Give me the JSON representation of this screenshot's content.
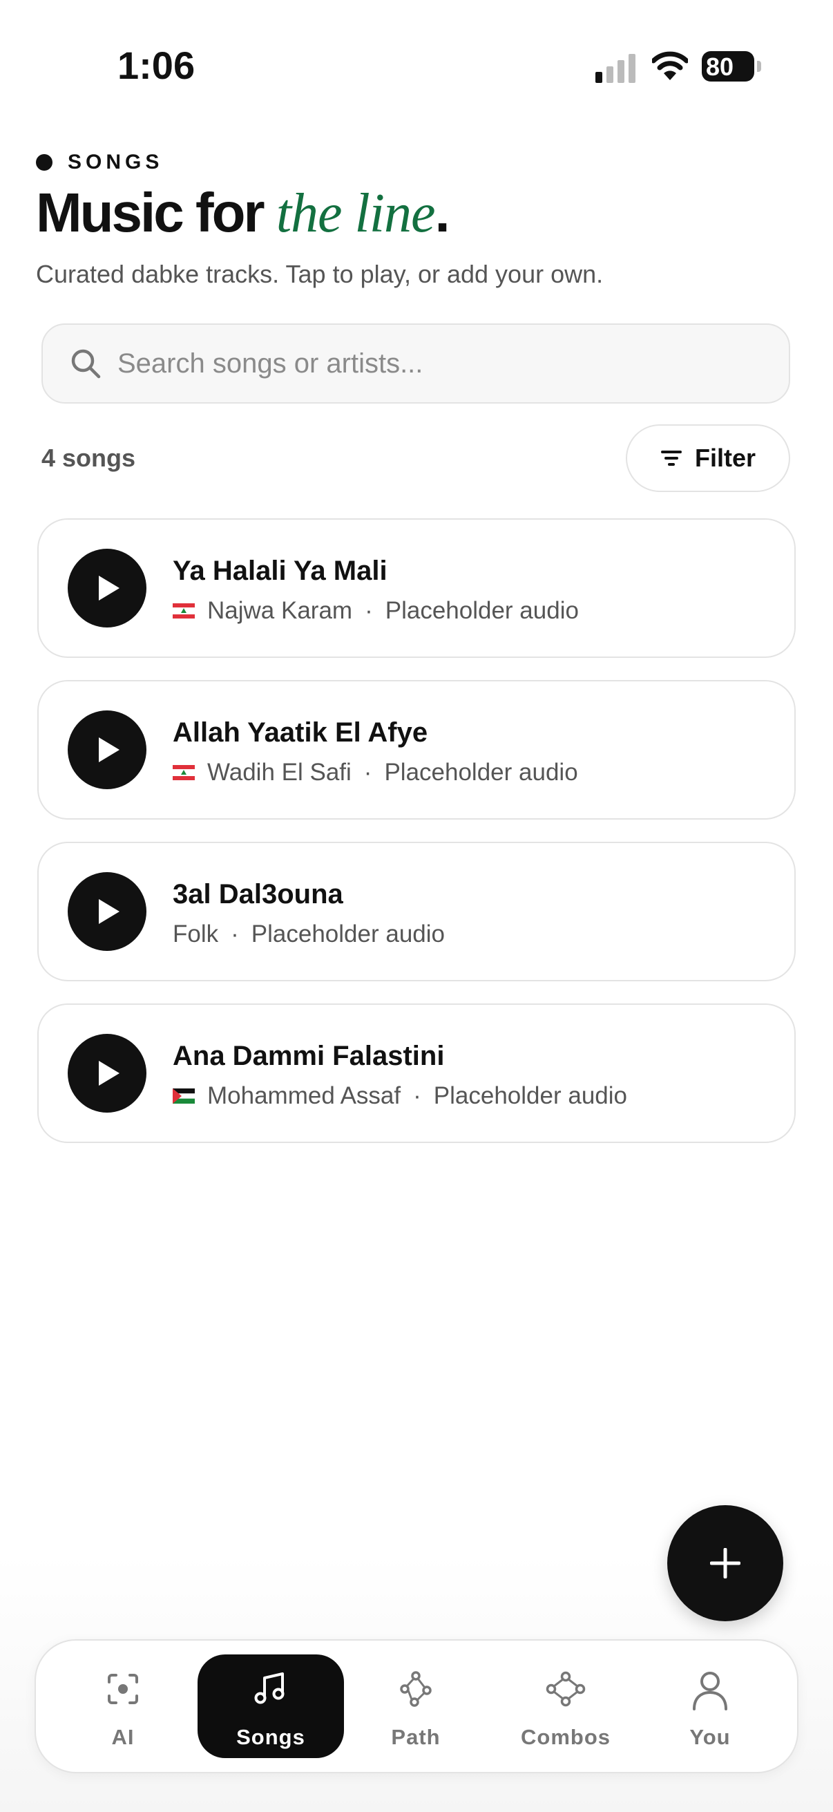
{
  "status_bar": {
    "time": "1:06",
    "battery": "80"
  },
  "header": {
    "eyebrow": "SONGS",
    "title_prefix": "Music for ",
    "title_accent": "the line",
    "title_suffix": ".",
    "subtitle": "Curated dabke tracks. Tap to play, or add your own."
  },
  "search": {
    "placeholder": "Search songs or artists...",
    "value": ""
  },
  "list_header": {
    "count": "4 songs",
    "filter_label": "Filter"
  },
  "songs": [
    {
      "title": "Ya Halali Ya Mali",
      "flag": "lebanon-flag-icon",
      "artist": "Najwa Karam",
      "note": "Placeholder audio"
    },
    {
      "title": "Allah Yaatik El Afye",
      "flag": "lebanon-flag-icon",
      "artist": "Wadih El Safi",
      "note": "Placeholder audio"
    },
    {
      "title": "3al Dal3ouna",
      "flag": "",
      "artist": "Folk",
      "note": "Placeholder audio"
    },
    {
      "title": "Ana Dammi Falastini",
      "flag": "palestine-flag-icon",
      "artist": "Mohammed Assaf",
      "note": "Placeholder audio"
    }
  ],
  "separator": "·",
  "fab": {
    "icon": "plus-icon"
  },
  "nav": {
    "items": [
      {
        "label": "AI",
        "icon": "ai-scan-icon",
        "active": false
      },
      {
        "label": "Songs",
        "icon": "music-note-icon",
        "active": true
      },
      {
        "label": "Path",
        "icon": "path-icon",
        "active": false
      },
      {
        "label": "Combos",
        "icon": "combos-icon",
        "active": false
      },
      {
        "label": "You",
        "icon": "person-icon",
        "active": false
      }
    ]
  },
  "colors": {
    "accent": "#137040",
    "primary": "#111111",
    "muted": "#555555"
  }
}
